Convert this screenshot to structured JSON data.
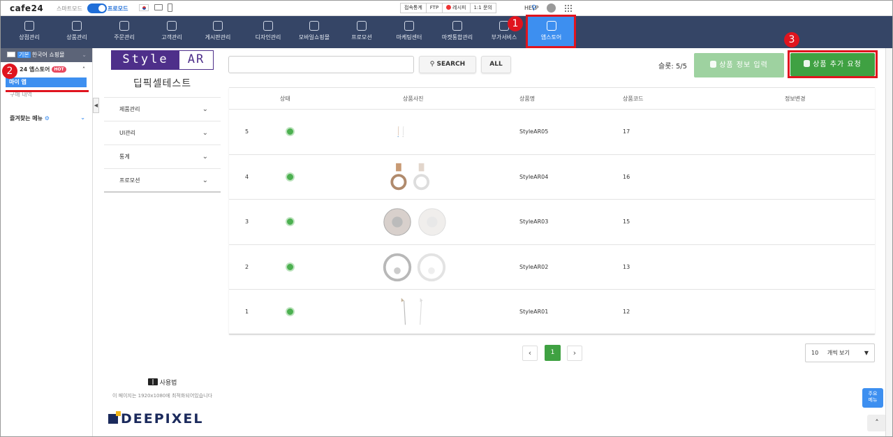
{
  "topbar": {
    "logo": "cafe24",
    "smart_mode": "스마트모드",
    "pro_mode": "프로모드",
    "buttons": [
      "접속통계",
      "FTP",
      "레시피",
      "1:1 문의"
    ],
    "help": "HELP"
  },
  "nav": {
    "items": [
      {
        "label": "상점관리",
        "icon": "home-icon"
      },
      {
        "label": "상품관리",
        "icon": "shirt-icon"
      },
      {
        "label": "주문관리",
        "icon": "cart-icon"
      },
      {
        "label": "고객관리",
        "icon": "users-icon"
      },
      {
        "label": "게시판관리",
        "icon": "board-icon"
      },
      {
        "label": "디자인관리",
        "icon": "palette-icon"
      },
      {
        "label": "모바일쇼핑몰",
        "icon": "mobile-icon"
      },
      {
        "label": "프로모션",
        "icon": "star-icon"
      },
      {
        "label": "마케팅센터",
        "icon": "monitor-icon"
      },
      {
        "label": "마켓통합관리",
        "icon": "network-icon"
      },
      {
        "label": "부가서비스",
        "icon": "plus-folder-icon"
      },
      {
        "label": "앱스토어",
        "icon": "apps-grid-icon"
      }
    ]
  },
  "annotations": {
    "one": "1",
    "two": "2",
    "three": "3"
  },
  "sidebar": {
    "shop_tag": "기본",
    "shop_name": "한국어 쇼핑몰",
    "appstore": "24 앱스토어",
    "hot": "HOT",
    "my_app": "마이 앱",
    "purchase": "구매 내역",
    "favorites": "즐겨찾는 메뉴"
  },
  "app": {
    "logo_left": "Style",
    "logo_right": "AR",
    "shop_name": "딥픽셀테스트",
    "menu": [
      "제품관리",
      "UI관리",
      "통계",
      "프로모션"
    ],
    "manual": "사용법",
    "optimized_note": "이 페이지는 1920x1080에 최적화되어있습니다",
    "brand": "DEEPIXEL"
  },
  "main": {
    "search_placeholder": "",
    "search_button": "SEARCH",
    "all_button": "ALL",
    "slot_label": "슬롯: 5/5",
    "info_button": "상품 정보 입력",
    "add_button": "상품 추가 요청",
    "columns": [
      "상태",
      "상품사진",
      "상품명",
      "상품코드",
      "정보변경"
    ],
    "rows": [
      {
        "num": "5",
        "name": "StyleAR05",
        "code": "17",
        "status": "active"
      },
      {
        "num": "4",
        "name": "StyleAR04",
        "code": "16",
        "status": "active"
      },
      {
        "num": "3",
        "name": "StyleAR03",
        "code": "15",
        "status": "active"
      },
      {
        "num": "2",
        "name": "StyleAR02",
        "code": "13",
        "status": "active"
      },
      {
        "num": "1",
        "name": "StyleAR01",
        "code": "12",
        "status": "active"
      }
    ],
    "page_current": "1",
    "per_page_count": "10",
    "per_page_label": "개씩 보기",
    "quick_menu": [
      "주요",
      "메뉴"
    ]
  },
  "colors": {
    "nav_bg": "#354566",
    "active_blue": "#3d8ff0",
    "highlight_red": "#e0141e",
    "green": "#3fa142",
    "brand_purple": "#4e2f8a"
  }
}
